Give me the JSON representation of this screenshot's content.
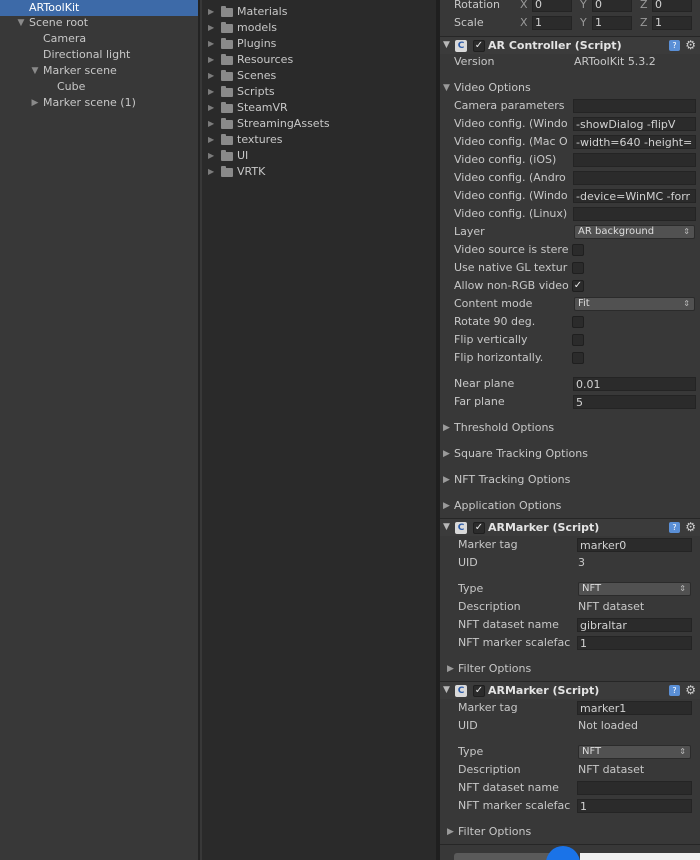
{
  "hierarchy": {
    "items": [
      {
        "label": "ARToolKit",
        "expanded": null,
        "selected": true
      },
      {
        "label": "Scene root",
        "expanded": true
      },
      {
        "label": "Camera"
      },
      {
        "label": "Directional light"
      },
      {
        "label": "Marker scene",
        "expanded": true
      },
      {
        "label": "Cube"
      },
      {
        "label": "Marker scene (1)",
        "expanded": false
      }
    ]
  },
  "project": {
    "folders": [
      "Materials",
      "models",
      "Plugins",
      "Resources",
      "Scenes",
      "Scripts",
      "SteamVR",
      "StreamingAssets",
      "textures",
      "UI",
      "VRTK"
    ]
  },
  "inspector": {
    "transform": {
      "rotation_label": "Rotation",
      "scale_label": "Scale",
      "axes": [
        "X",
        "Y",
        "Z"
      ],
      "rotation": [
        "0",
        "0",
        "0"
      ],
      "scale": [
        "1",
        "1",
        "1"
      ]
    },
    "ar_controller": {
      "title": "AR Controller (Script)",
      "enabled": true,
      "version_label": "Version",
      "version_value": "ARToolKit 5.3.2",
      "video_options_label": "Video Options",
      "camera_params_label": "Camera parameters",
      "camera_params_value": "",
      "video_cfg_windows_label": "Video config. (Windo",
      "video_cfg_windows_value": "-showDialog -flipV",
      "video_cfg_mac_label": "Video config. (Mac O",
      "video_cfg_mac_value": "-width=640 -height=",
      "video_cfg_ios_label": "Video config. (iOS)",
      "video_cfg_ios_value": "",
      "video_cfg_android_label": "Video config. (Andro",
      "video_cfg_android_value": "",
      "video_cfg_winmc_label": "Video config. (Windo",
      "video_cfg_winmc_value": "-device=WinMC -forr",
      "video_cfg_linux_label": "Video config. (Linux)",
      "video_cfg_linux_value": "",
      "layer_label": "Layer",
      "layer_value": "AR background",
      "stereo_label": "Video source is stere",
      "stereo_checked": false,
      "native_gl_label": "Use native GL textur",
      "native_gl_checked": false,
      "non_rgb_label": "Allow non-RGB video",
      "non_rgb_checked": true,
      "content_mode_label": "Content mode",
      "content_mode_value": "Fit",
      "rotate_label": "Rotate 90 deg.",
      "rotate_checked": false,
      "flip_v_label": "Flip vertically",
      "flip_v_checked": false,
      "flip_h_label": "Flip horizontally.",
      "flip_h_checked": false,
      "near_label": "Near plane",
      "near_value": "0.01",
      "far_label": "Far plane",
      "far_value": "5",
      "threshold_label": "Threshold Options",
      "square_label": "Square Tracking Options",
      "nft_label": "NFT Tracking Options",
      "app_label": "Application Options"
    },
    "markers": [
      {
        "title": "ARMarker (Script)",
        "enabled": true,
        "tag_label": "Marker tag",
        "tag_value": "marker0",
        "uid_label": "UID",
        "uid_value": "3",
        "type_label": "Type",
        "type_value": "NFT",
        "desc_label": "Description",
        "desc_value": "NFT dataset",
        "dataset_label": "NFT dataset name",
        "dataset_value": "gibraltar",
        "scale_label": "NFT marker scalefac",
        "scale_value": "1",
        "filter_label": "Filter Options"
      },
      {
        "title": "ARMarker (Script)",
        "enabled": true,
        "tag_label": "Marker tag",
        "tag_value": "marker1",
        "uid_label": "UID",
        "uid_value": "Not loaded",
        "type_label": "Type",
        "type_value": "NFT",
        "desc_label": "Description",
        "desc_value": "NFT dataset",
        "dataset_label": "NFT dataset name",
        "dataset_value": "",
        "scale_label": "NFT marker scalefac",
        "scale_value": "1",
        "filter_label": "Filter Options"
      }
    ]
  },
  "icons": {
    "folder": "folder-icon",
    "help": "help-icon",
    "gear": "gear-icon",
    "script": "script-icon"
  },
  "colors": {
    "selection": "#3d6aa8",
    "panel_bg": "#383838",
    "project_bg": "#2a2a2a"
  }
}
